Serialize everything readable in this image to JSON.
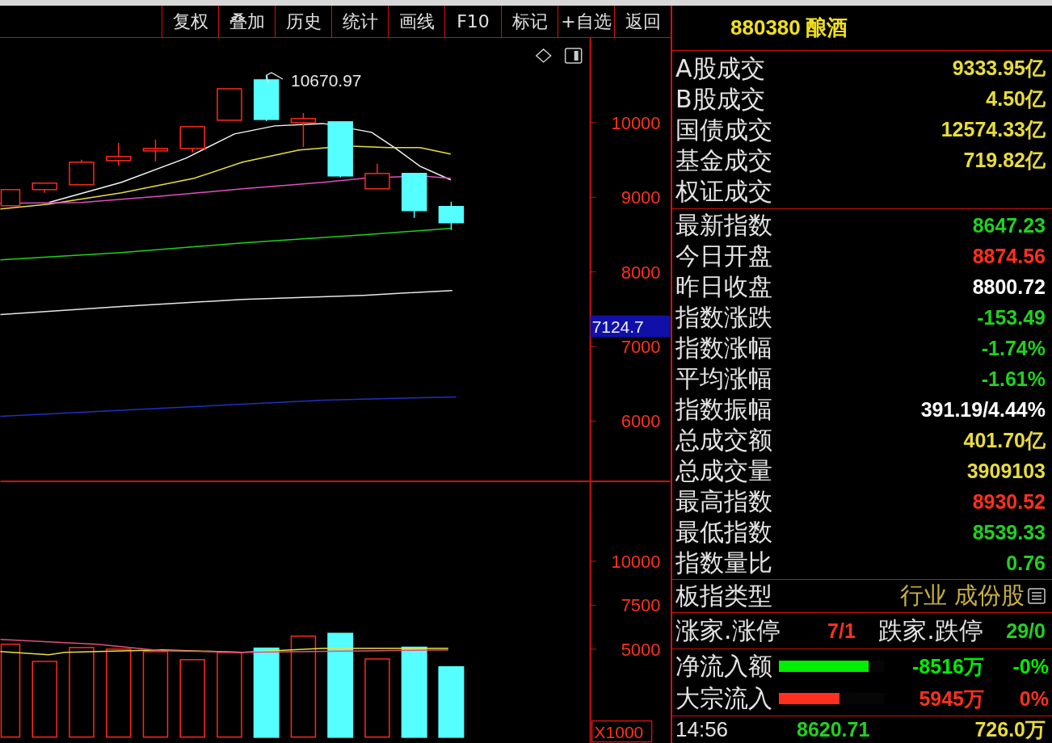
{
  "toolbar": [
    "复权",
    "叠加",
    "历史",
    "统计",
    "画线",
    "F10",
    "标记",
    "+自选",
    "返回"
  ],
  "price_chart": {
    "high_label": "10670.97",
    "ticks": [
      "10000",
      "9000",
      "8000",
      "7000",
      "6000"
    ],
    "current_label": "7124.7"
  },
  "volume_chart": {
    "ticks": [
      "10000",
      "7500",
      "5000"
    ],
    "unit_label": "X1000"
  },
  "quote": {
    "code": "880380",
    "name": "酿酒"
  },
  "turnover": [
    {
      "label": "A股成交",
      "value": "9333.95亿",
      "color": "#e8dc3c"
    },
    {
      "label": "B股成交",
      "value": "4.50亿",
      "color": "#e8dc3c"
    },
    {
      "label": "国债成交",
      "value": "12574.33亿",
      "color": "#e8dc3c"
    },
    {
      "label": "基金成交",
      "value": "719.82亿",
      "color": "#e8dc3c"
    },
    {
      "label": "权证成交"
    }
  ],
  "index_stats": [
    {
      "label": "最新指数",
      "value": "8647.23",
      "color": "#22d022"
    },
    {
      "label": "今日开盘",
      "value": "8874.56",
      "color": "#ff3020"
    },
    {
      "label": "昨日收盘",
      "value": "8800.72",
      "color": "#ffffff"
    },
    {
      "label": "指数涨跌",
      "value": "-153.49",
      "color": "#22d022"
    },
    {
      "label": "指数涨幅",
      "value": "-1.74%",
      "color": "#22d022"
    },
    {
      "label": "平均涨幅",
      "value": "-1.61%",
      "color": "#22d022"
    },
    {
      "label": "指数振幅",
      "value": "391.19/4.44%",
      "color": "#ffffff"
    },
    {
      "label": "总成交额",
      "value": "401.70亿",
      "color": "#e8dc3c"
    },
    {
      "label": "总成交量",
      "value": "3909103",
      "color": "#e8dc3c"
    },
    {
      "label": "最高指数",
      "value": "8930.52",
      "color": "#ff3020"
    },
    {
      "label": "最低指数",
      "value": "8539.33",
      "color": "#22d022"
    },
    {
      "label": "指数量比",
      "value": "0.76",
      "color": "#22d022"
    }
  ],
  "sector_type": {
    "label": "板指类型",
    "value": "行业 成份股"
  },
  "breadth": {
    "up_label": "涨家.涨停",
    "up_value": "7/1",
    "down_label": "跌家.跌停",
    "down_value": "29/0"
  },
  "flows": [
    {
      "label": "净流入额",
      "level": 0.85,
      "color": "#00ee00",
      "value": "-8516万",
      "percent": "-0%"
    },
    {
      "label": "大宗流入",
      "level": 0.58,
      "color": "#ff3020",
      "value": "5945万",
      "percent": "0%"
    }
  ],
  "tick": {
    "time": "14:56",
    "price": "8620.71",
    "volume": "726.0万"
  }
}
